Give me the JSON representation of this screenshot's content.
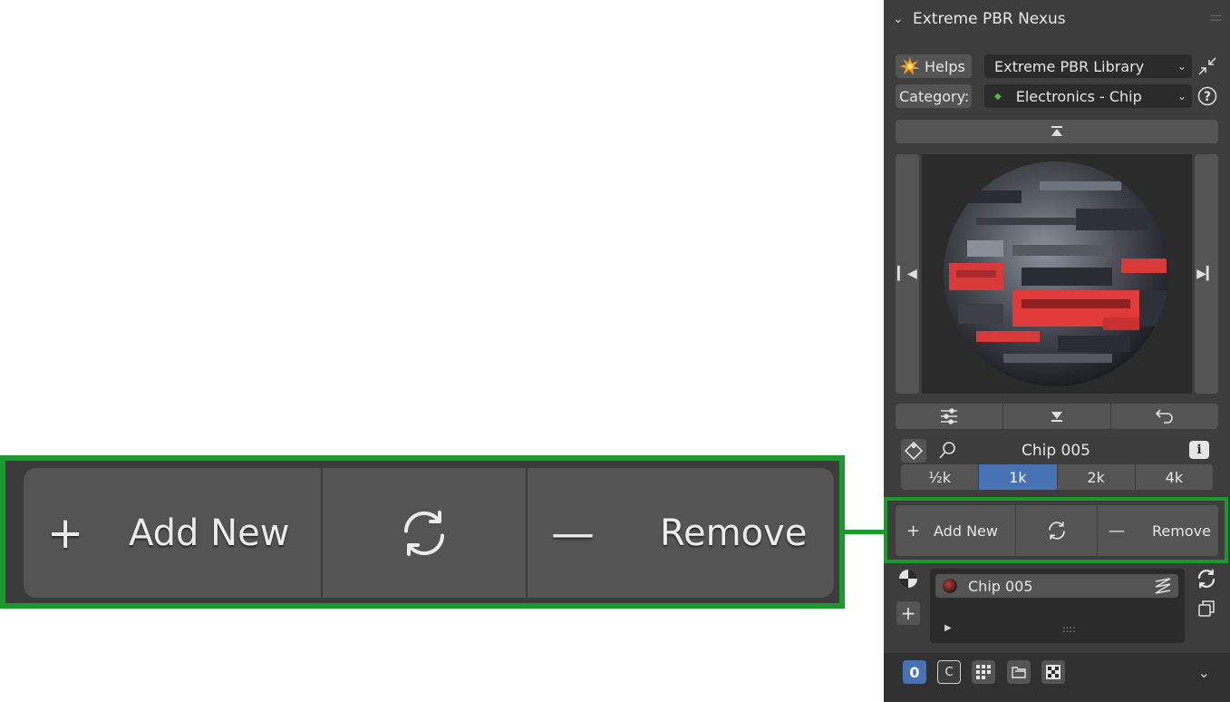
{
  "panel": {
    "title": "Extreme PBR Nexus",
    "collapse_icon": "chevron-down-icon",
    "grip_icon": "drag-grip-icon"
  },
  "helps": {
    "label": "Helps",
    "icon": "sparkle-icon"
  },
  "library": {
    "selected": "Extreme PBR Library"
  },
  "category": {
    "label": "Category:",
    "selected": "Electronics - Chip",
    "dot_color": "#49c13b"
  },
  "material": {
    "name": "Chip 005"
  },
  "resolution": {
    "options": [
      "½k",
      "1k",
      "2k",
      "4k"
    ],
    "active": "1k",
    "active_color": "#4772b3"
  },
  "actions": {
    "add_label": "Add New",
    "refresh_icon": "refresh-icon",
    "remove_label": "Remove"
  },
  "zoom": {
    "add_label": "Add New",
    "remove_label": "Remove"
  },
  "slots": {
    "item_label": "Chip 005",
    "grip": "::::"
  },
  "footer": {
    "zero_label": "0",
    "c_label": "C"
  },
  "accent": {
    "highlight_green": "#1a9a2a"
  }
}
